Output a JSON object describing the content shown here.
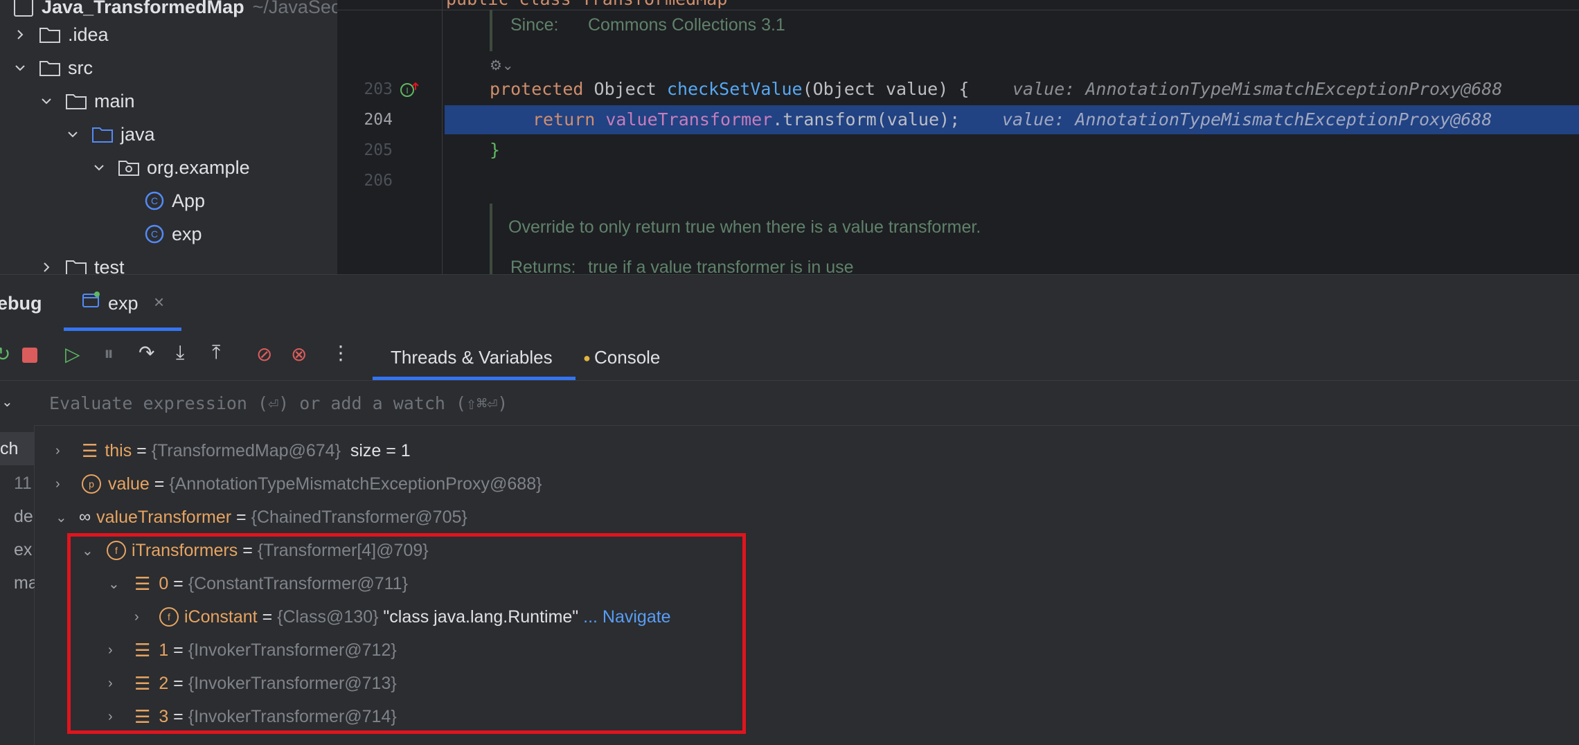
{
  "project": {
    "root_name": "Java_TransformedMap",
    "root_path": "~/JavaSec",
    "items": [
      {
        "label": ".idea",
        "icon": "folder-icon"
      },
      {
        "label": "src",
        "icon": "folder-icon"
      },
      {
        "label": "main",
        "icon": "folder-icon"
      },
      {
        "label": "java",
        "icon": "source-folder-icon"
      },
      {
        "label": "org.example",
        "icon": "package-icon"
      },
      {
        "label": "App",
        "icon": "class-icon"
      },
      {
        "label": "exp",
        "icon": "class-icon"
      },
      {
        "label": "test",
        "icon": "folder-icon"
      }
    ]
  },
  "editor": {
    "top_partial": "public class TransformedMap",
    "doc_since_label": "Since:",
    "doc_since_value": "Commons Collections 3.1",
    "lines": [
      {
        "num": "203",
        "kw": "protected",
        "text1": " Object ",
        "fn": "checkSetValue",
        "text2": "(Object value) {",
        "hint": "value: AnnotationTypeMismatchExceptionProxy@688"
      },
      {
        "num": "204",
        "kw": "return",
        "fn": "valueTransformer",
        "text2": ".transform(value);",
        "hint": "value: AnnotationTypeMismatchExceptionProxy@688"
      },
      {
        "num": "205",
        "text": "}"
      },
      {
        "num": "206",
        "text": ""
      }
    ],
    "doc_override": "Override to only return true when there is a value transformer.",
    "doc_returns_label": "Returns:",
    "doc_returns_value": "true if a value transformer is in use"
  },
  "debug": {
    "panel_title": "ebug",
    "session_tab": "exp",
    "tabs": [
      "Threads & Variables",
      "Console"
    ],
    "eval_placeholder": "Evaluate expression (⏎) or add a watch (⇧⌘⏎)",
    "frames": [
      "ch",
      "11",
      "de",
      "ex",
      "ma"
    ],
    "variables": [
      {
        "name": "this",
        "eq": "=",
        "value": "{TransformedMap@674}",
        "extra": "size = 1"
      },
      {
        "name": "value",
        "eq": "=",
        "value": "{AnnotationTypeMismatchExceptionProxy@688}"
      },
      {
        "name": "valueTransformer",
        "eq": "=",
        "value": "{ChainedTransformer@705}"
      },
      {
        "name": "iTransformers",
        "eq": "=",
        "value": "{Transformer[4]@709}"
      },
      {
        "name": "0",
        "eq": "=",
        "value": "{ConstantTransformer@711}"
      },
      {
        "name": "iConstant",
        "eq": "=",
        "value": "{Class@130}",
        "extra": "\"class java.lang.Runtime\"",
        "link": "... Navigate"
      },
      {
        "name": "1",
        "eq": "=",
        "value": "{InvokerTransformer@712}"
      },
      {
        "name": "2",
        "eq": "=",
        "value": "{InvokerTransformer@713}"
      },
      {
        "name": "3",
        "eq": "=",
        "value": "{InvokerTransformer@714}"
      }
    ]
  },
  "colors": {
    "highlight": "#214283",
    "redbox": "#e0141e",
    "accent": "#3574f0"
  }
}
